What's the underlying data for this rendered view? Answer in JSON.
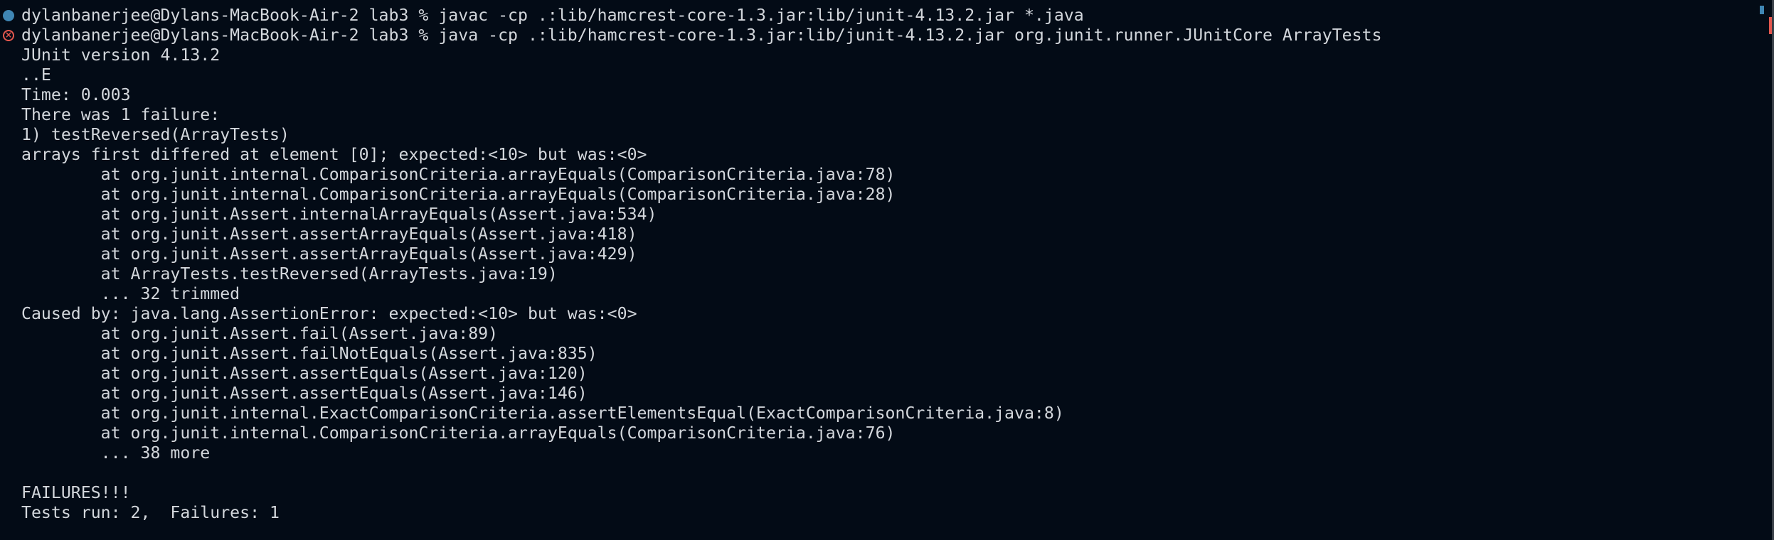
{
  "colors": {
    "background": "#030b16",
    "text": "#d3d7dc",
    "success_marker": "#3f86b4",
    "error_marker": "#e5584f"
  },
  "lines": [
    {
      "marker": "success",
      "text": "dylanbanerjee@Dylans-MacBook-Air-2 lab3 % javac -cp .:lib/hamcrest-core-1.3.jar:lib/junit-4.13.2.jar *.java"
    },
    {
      "marker": "error",
      "text": "dylanbanerjee@Dylans-MacBook-Air-2 lab3 % java -cp .:lib/hamcrest-core-1.3.jar:lib/junit-4.13.2.jar org.junit.runner.JUnitCore ArrayTests"
    },
    {
      "text": "JUnit version 4.13.2"
    },
    {
      "text": "..E"
    },
    {
      "text": "Time: 0.003"
    },
    {
      "text": "There was 1 failure:"
    },
    {
      "text": "1) testReversed(ArrayTests)"
    },
    {
      "text": "arrays first differed at element [0]; expected:<10> but was:<0>"
    },
    {
      "text": "        at org.junit.internal.ComparisonCriteria.arrayEquals(ComparisonCriteria.java:78)"
    },
    {
      "text": "        at org.junit.internal.ComparisonCriteria.arrayEquals(ComparisonCriteria.java:28)"
    },
    {
      "text": "        at org.junit.Assert.internalArrayEquals(Assert.java:534)"
    },
    {
      "text": "        at org.junit.Assert.assertArrayEquals(Assert.java:418)"
    },
    {
      "text": "        at org.junit.Assert.assertArrayEquals(Assert.java:429)"
    },
    {
      "text": "        at ArrayTests.testReversed(ArrayTests.java:19)"
    },
    {
      "text": "        ... 32 trimmed"
    },
    {
      "text": "Caused by: java.lang.AssertionError: expected:<10> but was:<0>"
    },
    {
      "text": "        at org.junit.Assert.fail(Assert.java:89)"
    },
    {
      "text": "        at org.junit.Assert.failNotEquals(Assert.java:835)"
    },
    {
      "text": "        at org.junit.Assert.assertEquals(Assert.java:120)"
    },
    {
      "text": "        at org.junit.Assert.assertEquals(Assert.java:146)"
    },
    {
      "text": "        at org.junit.internal.ExactComparisonCriteria.assertElementsEqual(ExactComparisonCriteria.java:8)"
    },
    {
      "text": "        at org.junit.internal.ComparisonCriteria.arrayEquals(ComparisonCriteria.java:76)"
    },
    {
      "text": "        ... 38 more"
    },
    {
      "text": ""
    },
    {
      "text": "FAILURES!!!"
    },
    {
      "text": "Tests run: 2,  Failures: 1"
    }
  ]
}
